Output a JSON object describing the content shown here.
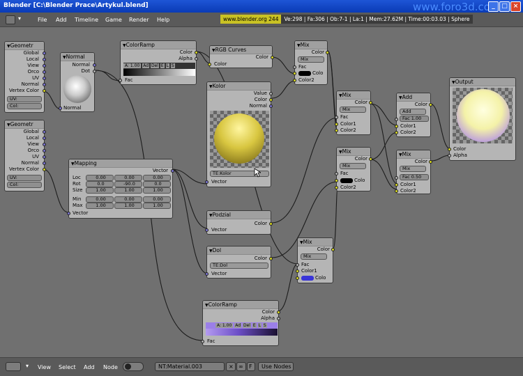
{
  "window": {
    "title": "Blender [C:\\Blender Prace\\Artykul.blend]",
    "watermark": "www.foro3d.co"
  },
  "menu": {
    "items": [
      "File",
      "Add",
      "Timeline",
      "Game",
      "Render",
      "Help"
    ]
  },
  "info": {
    "url": "www.blender.org 244",
    "stats": "Ve:298 | Fa:306 | Ob:7-1 | La:1 | Mem:27.62M | Time:00:03.03 | Sphere"
  },
  "nodes": {
    "geom1": {
      "title": "Geometr",
      "outputs": [
        "Global",
        "Local",
        "View",
        "Orco",
        "UV",
        "Normal",
        "Vertex Color"
      ],
      "fields": [
        "UV:",
        "Col:"
      ]
    },
    "geom2": {
      "title": "Geometr",
      "outputs": [
        "Global",
        "Local",
        "View",
        "Orco",
        "UV",
        "Normal",
        "Vertex Color"
      ],
      "fields": [
        "UV:",
        "Col:"
      ]
    },
    "normal": {
      "title": "Normal",
      "outputs": [
        "Normal",
        "Dot"
      ],
      "input": "Normal"
    },
    "colorramp1": {
      "title": "ColorRamp",
      "outputs": [
        "Color",
        "Alpha"
      ],
      "input": "Fac",
      "bar": [
        "A: 1.00",
        "Ad",
        "Del",
        "E",
        "L",
        "S"
      ]
    },
    "rgbcurves": {
      "title": "RGB Curves",
      "output": "Color",
      "input": "Color"
    },
    "kolor": {
      "title": "Kolor",
      "outputs": [
        "Value",
        "Color",
        "Normal"
      ],
      "field": "TE:Kolor",
      "input": "Vector"
    },
    "mix1": {
      "title": "Mix",
      "output": "Color",
      "mode": "Mix",
      "inputs": [
        "Fac",
        "Colo",
        "Color2"
      ]
    },
    "mix2": {
      "title": "Mix",
      "output": "Color",
      "mode": "Mix",
      "inputs": [
        "Fac",
        "Color1",
        "Color2"
      ]
    },
    "mix3": {
      "title": "Mix",
      "output": "Color",
      "mode": "Mix",
      "inputs": [
        "Fac",
        "Colo",
        "Color2"
      ]
    },
    "mix4": {
      "title": "Mix",
      "output": "Color",
      "mode": "Mix",
      "inputs": [
        "Fac",
        "Color1",
        "Colo"
      ]
    },
    "mix5": {
      "title": "Mix",
      "output": "Color",
      "mode": "Mix",
      "fac": "Fac 0.50",
      "inputs": [
        "Color1",
        "Color2"
      ]
    },
    "add": {
      "title": "Add",
      "output": "Color",
      "mode": "Add",
      "fac": "Fac 1.00",
      "inputs": [
        "Color1",
        "Color2"
      ]
    },
    "output": {
      "title": "Output",
      "inputs": [
        "Color",
        "Alpha"
      ]
    },
    "mapping": {
      "title": "Mapping",
      "output": "Vector",
      "input": "Vector",
      "rows": [
        {
          "label": "Loc",
          "values": [
            "0.00",
            "0.00",
            "0.00"
          ]
        },
        {
          "label": "Rot",
          "values": [
            "0.0",
            "-90.0",
            "0.0"
          ]
        },
        {
          "label": "Size",
          "values": [
            "1.00",
            "1.00",
            "1.00"
          ]
        },
        {
          "label": "Min",
          "values": [
            "0.00",
            "0.00",
            "0.00"
          ]
        },
        {
          "label": "Max",
          "values": [
            "1.00",
            "1.00",
            "1.00"
          ]
        }
      ]
    },
    "podzial": {
      "title": "Podzial",
      "output": "Color",
      "input": "Vector"
    },
    "dol": {
      "title": "Dol",
      "output": "Color",
      "field": "TE:Dol",
      "input": "Vector"
    },
    "colorramp2": {
      "title": "ColorRamp",
      "outputs": [
        "Color",
        "Alpha"
      ],
      "input": "Fac",
      "bar": [
        "A: 1.00",
        "Ad",
        "Del",
        "E",
        "L",
        "S"
      ]
    }
  },
  "bottom": {
    "items": [
      "View",
      "Select",
      "Add",
      "Node"
    ],
    "material": "NT:Material.003",
    "f_label": "F",
    "use_nodes": "Use Nodes"
  },
  "colors": {
    "socket_color": "#d6d621",
    "socket_vector": "#7a73d0",
    "swatch_blue": "#3a35d8"
  }
}
